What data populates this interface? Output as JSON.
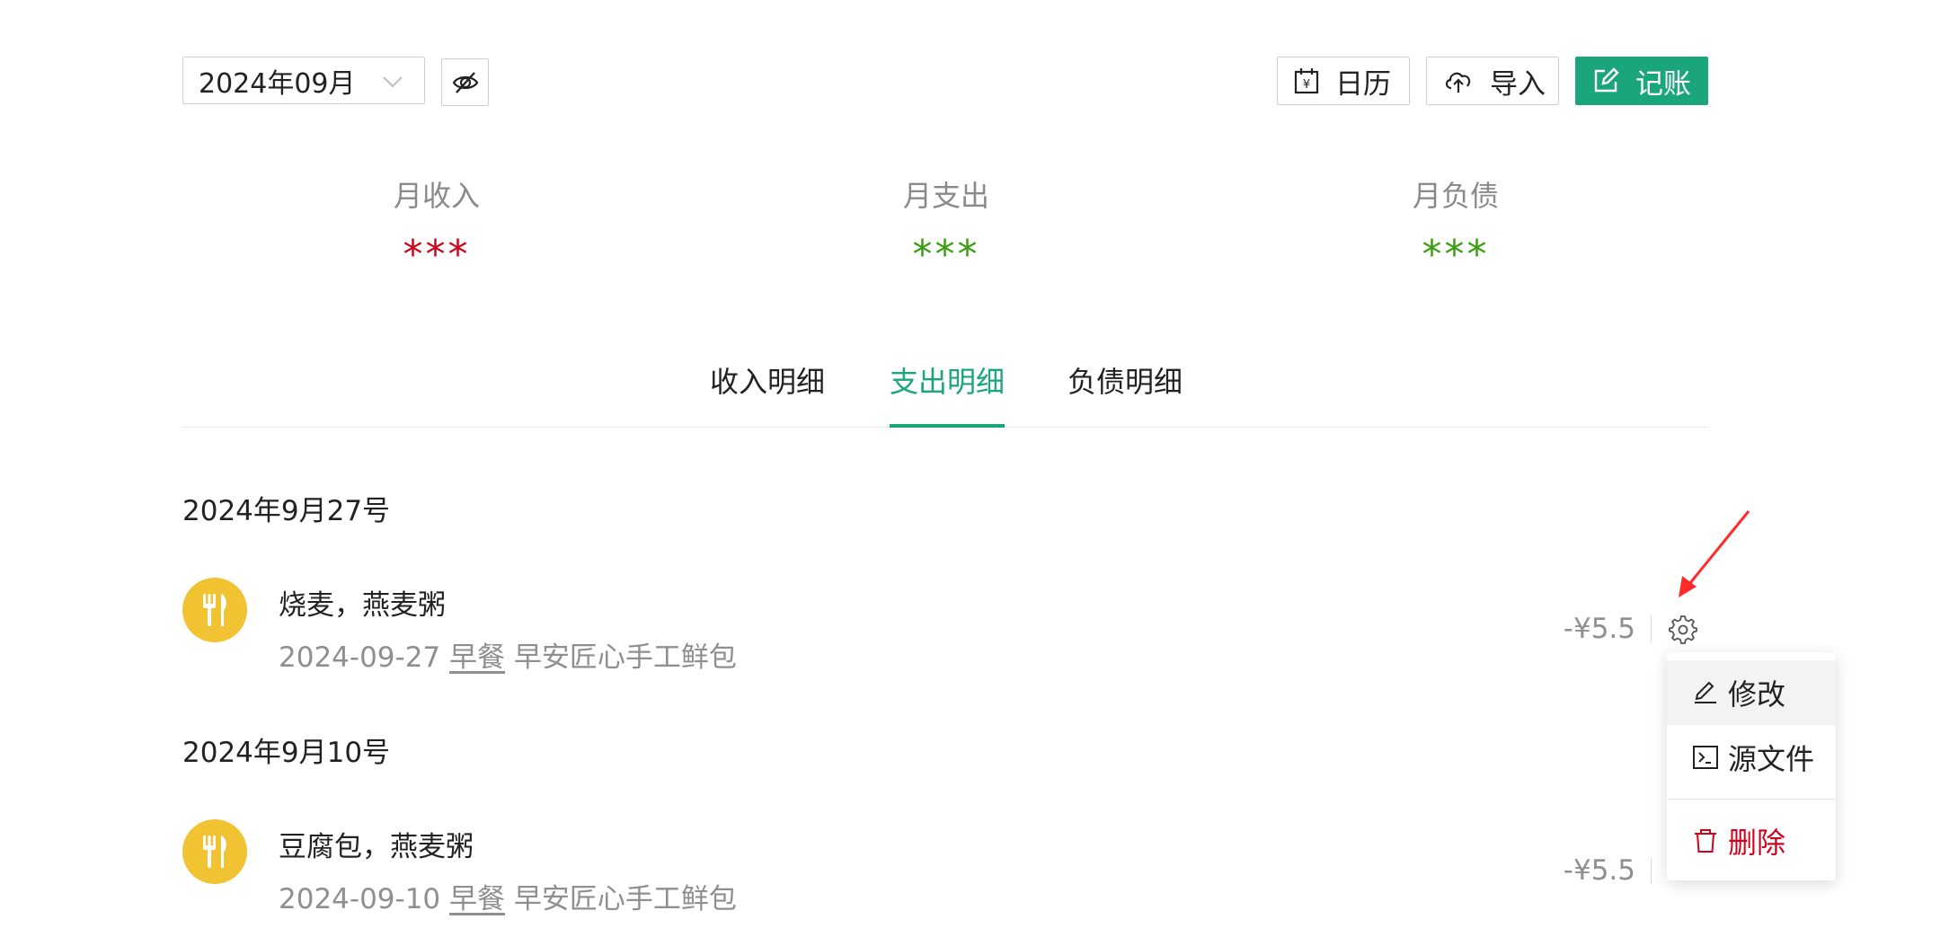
{
  "toolbar": {
    "month_value": "2024年09月",
    "calendar_label": "日历",
    "import_label": "导入",
    "record_label": "记账"
  },
  "summary": {
    "income_label": "月收入",
    "income_value": "***",
    "expense_label": "月支出",
    "expense_value": "***",
    "debt_label": "月负债",
    "debt_value": "***"
  },
  "tabs": [
    {
      "label": "收入明细",
      "active": false
    },
    {
      "label": "支出明细",
      "active": true
    },
    {
      "label": "负债明细",
      "active": false
    }
  ],
  "groups": [
    {
      "date": "2024年9月27号",
      "record": {
        "title": "烧麦，燕麦粥",
        "date": "2024-09-27",
        "category": "早餐",
        "merchant": "早安匠心手工鲜包",
        "amount": "-¥5.5",
        "icon": "fork-knife-icon"
      }
    },
    {
      "date": "2024年9月10号",
      "record": {
        "title": "豆腐包，燕麦粥",
        "date": "2024-09-10",
        "category": "早餐",
        "merchant": "早安匠心手工鲜包",
        "amount": "-¥5.5",
        "icon": "fork-knife-icon"
      }
    }
  ],
  "menu": {
    "edit_label": "修改",
    "source_label": "源文件",
    "delete_label": "删除"
  },
  "colors": {
    "accent": "#1aa57c",
    "income_red": "#d0021b",
    "expense_green": "#389e0d",
    "icon_yellow": "#f1c232",
    "annotation_red": "#ff2a2a"
  }
}
